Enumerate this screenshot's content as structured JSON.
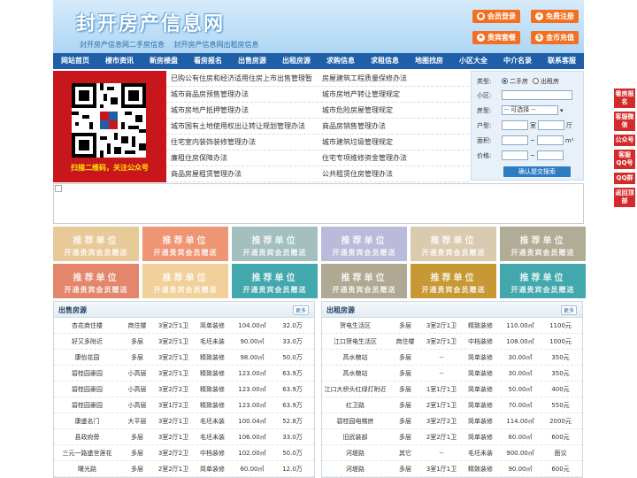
{
  "header": {
    "title": "封开房产信息网",
    "subtitles": [
      "封开房产信息网二手房信息",
      "封开房产信息网出租房信息"
    ],
    "buttons": [
      {
        "label": "会员登录",
        "icon": "user-icon"
      },
      {
        "label": "免费注册",
        "icon": "register-icon"
      },
      {
        "label": "贵宾套餐",
        "icon": "vip-icon"
      },
      {
        "label": "金币充值",
        "icon": "coin-icon"
      }
    ],
    "accent": "#f37021"
  },
  "nav": [
    "网站首页",
    "楼市资讯",
    "新房楼盘",
    "看房报名",
    "出售房源",
    "出租房源",
    "求购信息",
    "求租信息",
    "地图找房",
    "小区大全",
    "中介名录",
    "联系客服"
  ],
  "qr": {
    "caption": "扫描二维码，关注公众号"
  },
  "links": [
    [
      "已购公有住房和经济适用住房上市出售管理暂",
      "房屋建筑工程质量保修办法"
    ],
    [
      "城市商品房预售管理办法",
      "城市房地产转让管理规定"
    ],
    [
      "城市房地产抵押管理办法",
      "城市危险房屋管理规定"
    ],
    [
      "城市国有土地使用权出让转让规划管理办法",
      "商品房销售管理办法"
    ],
    [
      "住宅室内装饰装修管理办法",
      "城市建筑垃圾管理规定"
    ],
    [
      "廉租住房保障办法",
      "住宅专项维修资金管理办法"
    ],
    [
      "商品房屋租赁管理办法",
      "公共租赁住房管理办法"
    ]
  ],
  "search": {
    "type_label": "类型:",
    "type_options": [
      "二手房",
      "出租房"
    ],
    "community_label": "小区:",
    "housetype_label": "房型:",
    "housetype_value": "-- 可选择 --",
    "layout_label": "户型:",
    "room_unit": "室",
    "hall_unit": "厅",
    "area_label": "面积:",
    "area_unit": "m²",
    "price_label": "价格:",
    "tilde": "~",
    "submit": "确认提交搜索"
  },
  "tiles": {
    "title": "推荐单位",
    "subtitle": "开通贵宾会员赠送",
    "colors": [
      "#e6c58e",
      "#ee8a66",
      "#9bb9b9",
      "#b3b4d6",
      "#d7c6a8",
      "#a8a48a",
      "#e17a5c",
      "#f0cc8e",
      "#2f9fa5",
      "#a79f88",
      "#c18d1f",
      "#2f9fa5"
    ]
  },
  "sale": {
    "title": "出售房源",
    "more": "更多",
    "rows": [
      [
        "杏花商住楼",
        "商住楼",
        "3室2厅1卫",
        "简单装修",
        "104.00㎡",
        "32.0万"
      ],
      [
        "好又多附近",
        "多层",
        "3室2厅1卫",
        "毛坯未装",
        "90.00㎡",
        "33.0万"
      ],
      [
        "康怡花园",
        "多层",
        "3室2厅1卫",
        "精致装修",
        "98.00㎡",
        "50.0万"
      ],
      [
        "碧桂园豪园",
        "小高层",
        "3室2厅1卫",
        "精致装修",
        "123.00㎡",
        "63.9万"
      ],
      [
        "碧桂园豪园",
        "小高层",
        "3室2厅2卫",
        "精致装修",
        "123.00㎡",
        "63.9万"
      ],
      [
        "碧桂园豪园",
        "小高层",
        "3室1厅2卫",
        "精致装修",
        "123.00㎡",
        "63.9万"
      ],
      [
        "康盛名门",
        "大平层",
        "3室2厅1卫",
        "毛坯未装",
        "100.04㎡",
        "52.8万"
      ],
      [
        "县政府旁",
        "多层",
        "3室2厅1卫",
        "毛坯未装",
        "106.00㎡",
        "33.0万"
      ],
      [
        "三元一路盛世莲花",
        "多层",
        "3室2厅2卫",
        "中档装修",
        "102.00㎡",
        "50.0万"
      ],
      [
        "曙光路",
        "多层",
        "2室2厅1卫",
        "简单装修",
        "60.00㎡",
        "12.0万"
      ]
    ]
  },
  "rent": {
    "title": "出租房源",
    "more": "更多",
    "rows": [
      [
        "贺电生活区",
        "多层",
        "3室2厅1卫",
        "精致装修",
        "110.00㎡",
        "1100元"
      ],
      [
        "江口贺电生活区",
        "商住楼",
        "3室2厅1卫",
        "中档装修",
        "108.00㎡",
        "1000元"
      ],
      [
        "高水粮站",
        "多层",
        "--",
        "简单装修",
        "30.00㎡",
        "350元"
      ],
      [
        "高水粮站",
        "多层",
        "--",
        "简单装修",
        "30.00㎡",
        "350元"
      ],
      [
        "江口大桥头红绿灯附近",
        "多层",
        "1室1厅1卫",
        "简单装修",
        "50.00㎡",
        "400元"
      ],
      [
        "红卫路",
        "多层",
        "2室1厅1卫",
        "简单装修",
        "70.00㎡",
        "550元"
      ],
      [
        "碧桂园电梯房",
        "多层",
        "3室2厅2卫",
        "简单装修",
        "114.00㎡",
        "2000元"
      ],
      [
        "旧武装部",
        "多层",
        "2室2厅1卫",
        "简单装修",
        "60.00㎡",
        "600元"
      ],
      [
        "河堤路",
        "其它",
        "--",
        "毛坯未装",
        "900.00㎡",
        "面议"
      ],
      [
        "河堤路",
        "多层",
        "3室1厅1卫",
        "精致装修",
        "90.00㎡",
        "600元"
      ]
    ]
  },
  "side": [
    "看房报名",
    "客服微信",
    "公众号",
    "客服QQ号",
    "QQ群",
    "返回顶部"
  ]
}
